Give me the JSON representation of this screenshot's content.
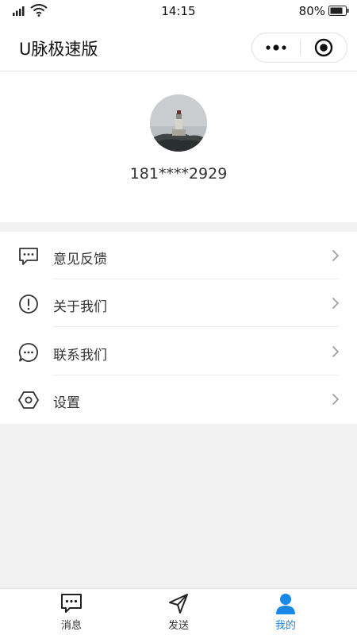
{
  "status_bar": {
    "time": "14:15",
    "battery": "80%"
  },
  "header": {
    "title": "U脉极速版"
  },
  "profile": {
    "phone": "181****2929"
  },
  "menu": [
    {
      "label": "意见反馈",
      "icon": "feedback-icon"
    },
    {
      "label": "关于我们",
      "icon": "info-icon"
    },
    {
      "label": "联系我们",
      "icon": "chat-icon"
    },
    {
      "label": "设置",
      "icon": "settings-icon"
    }
  ],
  "tabs": [
    {
      "label": "消息",
      "icon": "message-icon",
      "active": false
    },
    {
      "label": "发送",
      "icon": "send-icon",
      "active": false
    },
    {
      "label": "我的",
      "icon": "person-icon",
      "active": true
    }
  ],
  "colors": {
    "accent": "#1a88e6",
    "background": "#f2f2f2"
  }
}
